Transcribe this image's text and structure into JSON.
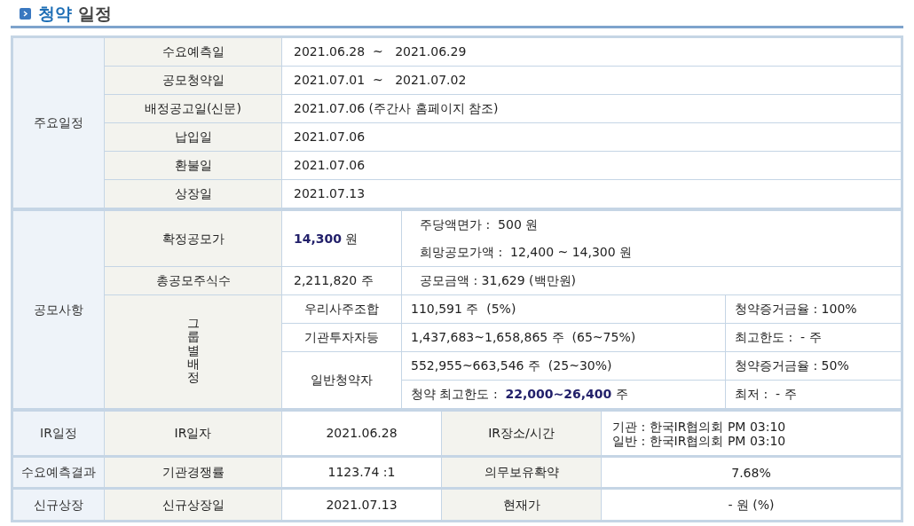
{
  "title": {
    "highlight": "청약",
    "rest": "일정"
  },
  "schedule": {
    "group": "주요일정",
    "rows": [
      {
        "label": "수요예측일",
        "value": "2021.06.28  ~   2021.06.29"
      },
      {
        "label": "공모청약일",
        "value": "2021.07.01  ~   2021.07.02"
      },
      {
        "label": "배정공고일(신문)",
        "value": "2021.07.06 (주간사 홈페이지 참조)"
      },
      {
        "label": "납입일",
        "value": "2021.07.06"
      },
      {
        "label": "환불일",
        "value": "2021.07.06"
      },
      {
        "label": "상장일",
        "value": "2021.07.13"
      }
    ]
  },
  "offering": {
    "group": "공모사항",
    "final_price": {
      "label": "확정공모가",
      "value": "**14,300** 원",
      "notes": [
        "주당액면가 :  500 원",
        "희망공모가액 :  12,400 ~ 14,300 원"
      ]
    },
    "total_shares": {
      "label": "총공모주식수",
      "value": "2,211,820 주",
      "note": "공모금액 : 31,629 (백만원)"
    },
    "allocation": {
      "label": "그룹별배정",
      "groups": [
        {
          "label": "우리사주조합",
          "lines": [
            {
              "value": "110,591 주  (5%)",
              "note": "청약증거금율 : 100%"
            }
          ]
        },
        {
          "label": "기관투자자등",
          "lines": [
            {
              "value": "1,437,683~1,658,865 주  (65~75%)",
              "note": "최고한도 :  - 주"
            }
          ]
        },
        {
          "label": "일반청약자",
          "lines": [
            {
              "value": "552,955~663,546 주  (25~30%)",
              "note": "청약증거금율 : 50%"
            },
            {
              "value": "청약 최고한도 :  **22,000~26,400** 주",
              "note": "최저 :  - 주"
            }
          ]
        }
      ]
    }
  },
  "results": [
    {
      "group": "IR일정",
      "label": "IR일자",
      "value": "2021.06.28",
      "label2": "IR장소/시간",
      "value2": [
        "기관 : 한국IR협의회 PM 03:10",
        "일반 : 한국IR협의회 PM 03:10"
      ]
    },
    {
      "group": "수요예측결과",
      "label": "기관경쟁률",
      "value": "1123.74 :1",
      "label2": "의무보유확약",
      "value2": [
        "7.68%"
      ]
    },
    {
      "group": "신규상장",
      "label": "신규상장일",
      "value": "2021.07.13",
      "label2": "현재가",
      "value2": [
        "- 원 (%)"
      ]
    }
  ]
}
